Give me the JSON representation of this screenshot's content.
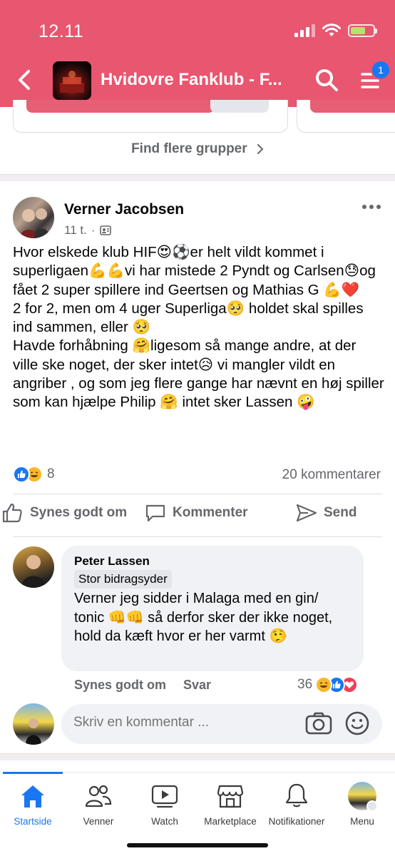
{
  "status_bar": {
    "time": "12.11"
  },
  "header": {
    "title": "Hvidovre Fanklub - F...",
    "notification_count": "1",
    "colors": {
      "background": "#e8566f",
      "badge": "#1877f2"
    }
  },
  "suggested": {
    "find_more_label": "Find flere grupper"
  },
  "post": {
    "author": "Verner Jacobsen",
    "time": "11 t.",
    "separator": "·",
    "text": "Hvor elskede klub HIF😍⚽er helt vildt kommet i superligaen💪💪vi har mistede 2 Pyndt og Carlsen😓og fået 2 super spillere ind Geertsen og Mathias G 💪❤️\n2 for 2, men om 4 uger Superliga🥺 holdet skal spilles ind sammen, eller 🥺\nHavde forhåbning 🤗ligesom så mange andre, at der ville ske noget, der sker intet😥  vi mangler vildt en angriber , og som jeg flere gange har nævnt en høj spiller som kan hjælpe Philip 🤗 intet sker Lassen 🤪",
    "reaction_count": "8",
    "comment_count": "20 kommentarer",
    "actions": {
      "like": "Synes godt om",
      "comment": "Kommenter",
      "share": "Send"
    }
  },
  "comment": {
    "author": "Peter Lassen",
    "role": "Stor bidragsyder",
    "text": "Verner jeg sidder i Malaga med en gin/ tonic 👊👊 så derfor sker der ikke noget, hold da kæft hvor er her varmt 🤥",
    "like_label": "Synes godt om",
    "reply_label": "Svar",
    "reaction_count": "36"
  },
  "composer": {
    "placeholder": "Skriv en kommentar ..."
  },
  "bottom_nav": {
    "items": [
      {
        "label": "Startside",
        "icon": "home-icon",
        "active": true
      },
      {
        "label": "Venner",
        "icon": "friends-icon"
      },
      {
        "label": "Watch",
        "icon": "watch-icon"
      },
      {
        "label": "Marketplace",
        "icon": "marketplace-icon"
      },
      {
        "label": "Notifikationer",
        "icon": "bell-icon"
      },
      {
        "label": "Menu",
        "icon": "profile-menu-icon"
      }
    ],
    "active_color": "#1877f2"
  }
}
